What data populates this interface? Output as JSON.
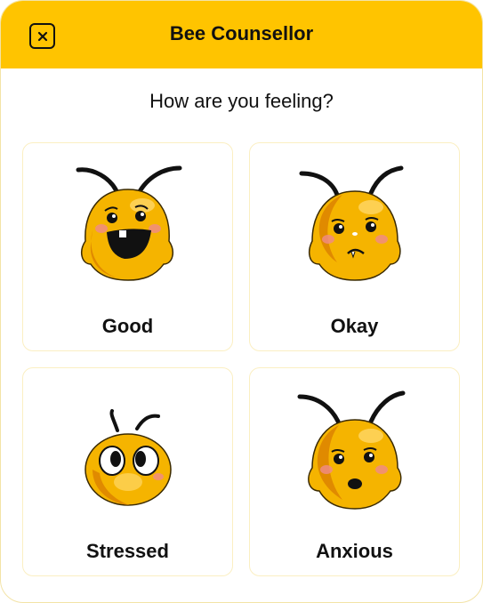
{
  "header": {
    "title": "Bee Counsellor"
  },
  "prompt": "How are you feeling?",
  "moods": [
    {
      "label": "Good"
    },
    {
      "label": "Okay"
    },
    {
      "label": "Stressed"
    },
    {
      "label": "Anxious"
    }
  ],
  "colors": {
    "header": "#ffc400",
    "bee_body": "#f5b400",
    "bee_shade": "#e08a00",
    "blush": "#f08a8a"
  },
  "icons": {
    "close": "close-icon"
  }
}
